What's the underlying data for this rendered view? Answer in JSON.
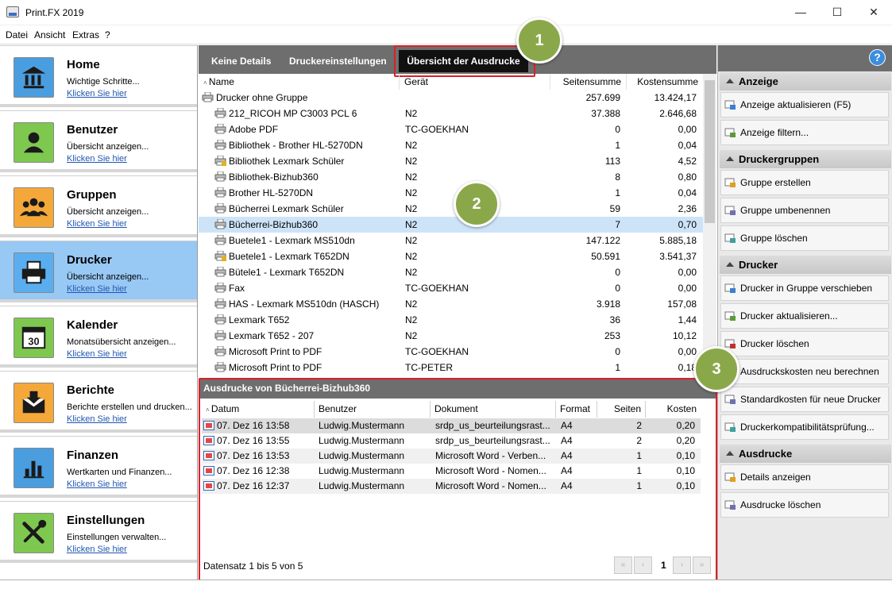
{
  "window": {
    "title": "Print.FX 2019",
    "minimize": "—",
    "maximize": "☐",
    "close": "✕"
  },
  "menu": [
    "Datei",
    "Ansicht",
    "Extras",
    "?"
  ],
  "nav": [
    {
      "title": "Home",
      "subtitle": "Wichtige Schritte...",
      "link": "Klicken Sie hier",
      "icon": "bank-icon",
      "color": "#4a9ee0",
      "active": false
    },
    {
      "title": "Benutzer",
      "subtitle": "Übersicht anzeigen...",
      "link": "Klicken Sie hier",
      "icon": "user-icon",
      "color": "#7ec850",
      "active": false
    },
    {
      "title": "Gruppen",
      "subtitle": "Übersicht anzeigen...",
      "link": "Klicken Sie hier",
      "icon": "group-icon",
      "color": "#f5a83a",
      "active": false
    },
    {
      "title": "Drucker",
      "subtitle": "Übersicht anzeigen...",
      "link": "Klicken Sie hier",
      "icon": "printer-icon",
      "color": "#5aaef0",
      "active": true
    },
    {
      "title": "Kalender",
      "subtitle": "Monatsübersicht anzeigen...",
      "link": "Klicken Sie hier",
      "icon": "calendar-icon",
      "color": "#7ec850",
      "active": false
    },
    {
      "title": "Berichte",
      "subtitle": "Berichte erstellen und drucken...",
      "link": "Klicken Sie hier",
      "icon": "report-icon",
      "color": "#f5a83a",
      "active": false
    },
    {
      "title": "Finanzen",
      "subtitle": "Wertkarten und Finanzen...",
      "link": "Klicken Sie hier",
      "icon": "chart-icon",
      "color": "#4a9ee0",
      "active": false
    },
    {
      "title": "Einstellungen",
      "subtitle": "Einstellungen verwalten...",
      "link": "Klicken Sie hier",
      "icon": "tools-icon",
      "color": "#7ec850",
      "active": false
    }
  ],
  "tabs": {
    "t1": "Keine Details",
    "t2": "Druckereinstellungen",
    "t3": "Übersicht der Ausdrucke"
  },
  "printer_table": {
    "headers": {
      "name": "Name",
      "device": "Gerät",
      "pages": "Seitensumme",
      "cost": "Kostensumme"
    },
    "rows": [
      {
        "name": "Drucker ohne Gruppe",
        "device": "",
        "pages": "257.699",
        "cost": "13.424,17",
        "group": true
      },
      {
        "name": "212_RICOH MP C3003 PCL 6",
        "device": "N2",
        "pages": "37.388",
        "cost": "2.646,68"
      },
      {
        "name": "Adobe PDF",
        "device": "TC-GOEKHAN",
        "pages": "0",
        "cost": "0,00"
      },
      {
        "name": "Bibliothek - Brother HL-5270DN",
        "device": "N2",
        "pages": "1",
        "cost": "0,04"
      },
      {
        "name": "Bibliothek Lexmark Schüler",
        "device": "N2",
        "pages": "113",
        "cost": "4,52",
        "lock": true
      },
      {
        "name": "Bibliothek-Bizhub360",
        "device": "N2",
        "pages": "8",
        "cost": "0,80"
      },
      {
        "name": "Brother HL-5270DN",
        "device": "N2",
        "pages": "1",
        "cost": "0,04"
      },
      {
        "name": "Bücherrei Lexmark Schüler",
        "device": "N2",
        "pages": "59",
        "cost": "2,36"
      },
      {
        "name": "Bücherrei-Bizhub360",
        "device": "N2",
        "pages": "7",
        "cost": "0,70",
        "selected": true
      },
      {
        "name": "Buetele1 - Lexmark MS510dn",
        "device": "N2",
        "pages": "147.122",
        "cost": "5.885,18"
      },
      {
        "name": "Buetele1 - Lexmark T652DN",
        "device": "N2",
        "pages": "50.591",
        "cost": "3.541,37",
        "lock": true
      },
      {
        "name": "Bütele1 - Lexmark T652DN",
        "device": "N2",
        "pages": "0",
        "cost": "0,00"
      },
      {
        "name": "Fax",
        "device": "TC-GOEKHAN",
        "pages": "0",
        "cost": "0,00"
      },
      {
        "name": "HAS - Lexmark MS510dn (HASCH)",
        "device": "N2",
        "pages": "3.918",
        "cost": "157,08"
      },
      {
        "name": "Lexmark T652",
        "device": "N2",
        "pages": "36",
        "cost": "1,44"
      },
      {
        "name": "Lexmark T652 - 207",
        "device": "N2",
        "pages": "253",
        "cost": "10,12"
      },
      {
        "name": "Microsoft Print to PDF",
        "device": "TC-GOEKHAN",
        "pages": "0",
        "cost": "0,00"
      },
      {
        "name": "Microsoft Print to PDF",
        "device": "TC-PETER",
        "pages": "1",
        "cost": "0,18"
      }
    ]
  },
  "detail": {
    "title": "Ausdrucke von Bücherrei-Bizhub360",
    "headers": {
      "date": "Datum",
      "user": "Benutzer",
      "doc": "Dokument",
      "format": "Format",
      "pages": "Seiten",
      "cost": "Kosten"
    },
    "rows": [
      {
        "date": "07. Dez 16 13:58",
        "user": "Ludwig.Mustermann",
        "doc": "srdp_us_beurteilungsrast...",
        "format": "A4",
        "pages": "2",
        "cost": "0,20"
      },
      {
        "date": "07. Dez 16 13:55",
        "user": "Ludwig.Mustermann",
        "doc": "srdp_us_beurteilungsrast...",
        "format": "A4",
        "pages": "2",
        "cost": "0,20"
      },
      {
        "date": "07. Dez 16 13:53",
        "user": "Ludwig.Mustermann",
        "doc": "Microsoft Word - Verben...",
        "format": "A4",
        "pages": "1",
        "cost": "0,10"
      },
      {
        "date": "07. Dez 16 12:38",
        "user": "Ludwig.Mustermann",
        "doc": "Microsoft Word - Nomen...",
        "format": "A4",
        "pages": "1",
        "cost": "0,10"
      },
      {
        "date": "07. Dez 16 12:37",
        "user": "Ludwig.Mustermann",
        "doc": "Microsoft Word - Nomen...",
        "format": "A4",
        "pages": "1",
        "cost": "0,10"
      }
    ],
    "record_info": "Datensatz 1 bis 5 von 5",
    "pager": {
      "first": "«",
      "prev": "‹",
      "page": "1",
      "next": "›",
      "last": "»"
    }
  },
  "actions": {
    "help": "?",
    "sections": [
      {
        "title": "Anzeige",
        "items": [
          {
            "label": "Anzeige aktualisieren (F5)",
            "icon": "refresh-icon"
          },
          {
            "label": "Anzeige filtern...",
            "icon": "filter-icon"
          }
        ]
      },
      {
        "title": "Druckergruppen",
        "items": [
          {
            "label": "Gruppe erstellen",
            "icon": "group-add-icon"
          },
          {
            "label": "Gruppe umbenennen",
            "icon": "group-rename-icon"
          },
          {
            "label": "Gruppe löschen",
            "icon": "group-delete-icon"
          }
        ]
      },
      {
        "title": "Drucker",
        "items": [
          {
            "label": "Drucker in Gruppe verschieben",
            "icon": "printer-move-icon"
          },
          {
            "label": "Drucker aktualisieren...",
            "icon": "printer-refresh-icon"
          },
          {
            "label": "Drucker löschen",
            "icon": "printer-delete-icon"
          },
          {
            "label": "Ausdruckskosten neu berechnen",
            "icon": "recalculate-icon"
          },
          {
            "label": "Standardkosten für neue Drucker",
            "icon": "default-cost-icon"
          },
          {
            "label": "Druckerkompatibilitätsprüfung...",
            "icon": "compat-icon"
          }
        ]
      },
      {
        "title": "Ausdrucke",
        "items": [
          {
            "label": "Details anzeigen",
            "icon": "info-icon"
          },
          {
            "label": "Ausdrucke löschen",
            "icon": "delete-prints-icon"
          }
        ]
      }
    ]
  },
  "callouts": [
    "1",
    "2",
    "3"
  ]
}
